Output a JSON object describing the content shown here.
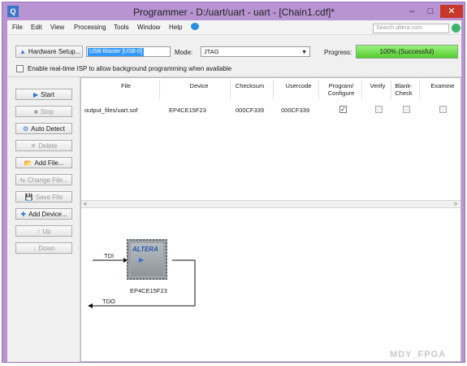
{
  "window": {
    "title": "Programmer - D:/uart/uart - uart - [Chain1.cdf]*",
    "app_icon_glyph": "Q",
    "min_glyph": "–",
    "max_glyph": "□",
    "close_glyph": "✕"
  },
  "menu": {
    "items": [
      "File",
      "Edit",
      "View",
      "Processing",
      "Tools",
      "Window",
      "Help"
    ],
    "search_placeholder": "Search altera.com"
  },
  "toolbar": {
    "hardware_setup_label": "Hardware Setup...",
    "hardware_value": "USB-Blaster [USB-0]",
    "mode_label": "Mode:",
    "mode_value": "JTAG",
    "progress_label": "Progress:",
    "progress_text": "100% (Successful)",
    "progress_percent": 100,
    "realtime_isp_label": "Enable real-time ISP to allow background programming when available"
  },
  "sidebar": {
    "buttons": [
      {
        "label": "Start",
        "icon": "start-icon",
        "glyph": "▶",
        "enabled": true
      },
      {
        "label": "Stop",
        "icon": "stop-icon",
        "glyph": "■",
        "enabled": false
      },
      {
        "label": "Auto Detect",
        "icon": "auto-detect-icon",
        "glyph": "⚙",
        "enabled": true
      },
      {
        "label": "Delete",
        "icon": "delete-icon",
        "glyph": "✕",
        "enabled": false
      },
      {
        "label": "Add File...",
        "icon": "add-file-icon",
        "glyph": "📂",
        "enabled": true
      },
      {
        "label": "Change File...",
        "icon": "change-file-icon",
        "glyph": "⇆",
        "enabled": false
      },
      {
        "label": "Save File",
        "icon": "save-file-icon",
        "glyph": "💾",
        "enabled": false
      },
      {
        "label": "Add Device...",
        "icon": "add-device-icon",
        "glyph": "✚",
        "enabled": true
      },
      {
        "label": "Up",
        "icon": "up-icon",
        "glyph": "↑",
        "enabled": false
      },
      {
        "label": "Down",
        "icon": "down-icon",
        "glyph": "↓",
        "enabled": false
      }
    ]
  },
  "table": {
    "headers": [
      "File",
      "Device",
      "Checksum",
      "Usercode",
      "Program/ Configure",
      "Verify",
      "Blank- Check",
      "Examine"
    ],
    "rows": [
      {
        "file": "output_files/uart.sof",
        "device": "EP4CE15F23",
        "checksum": "000CF339",
        "usercode": "000CF339",
        "program": true,
        "verify": false,
        "blank_check": false,
        "examine": false
      }
    ],
    "scroll_left": "<",
    "scroll_right": ">"
  },
  "diagram": {
    "tdi_label": "TDI",
    "tdo_label": "TDO",
    "device_label": "EP4CE15F23",
    "chip_logo": "ALTERA"
  },
  "watermark": "MDY_FPGA",
  "colors": {
    "window_frame": "#b894d2",
    "progress_fill": "#56cc2e",
    "selection": "#3399ff"
  }
}
